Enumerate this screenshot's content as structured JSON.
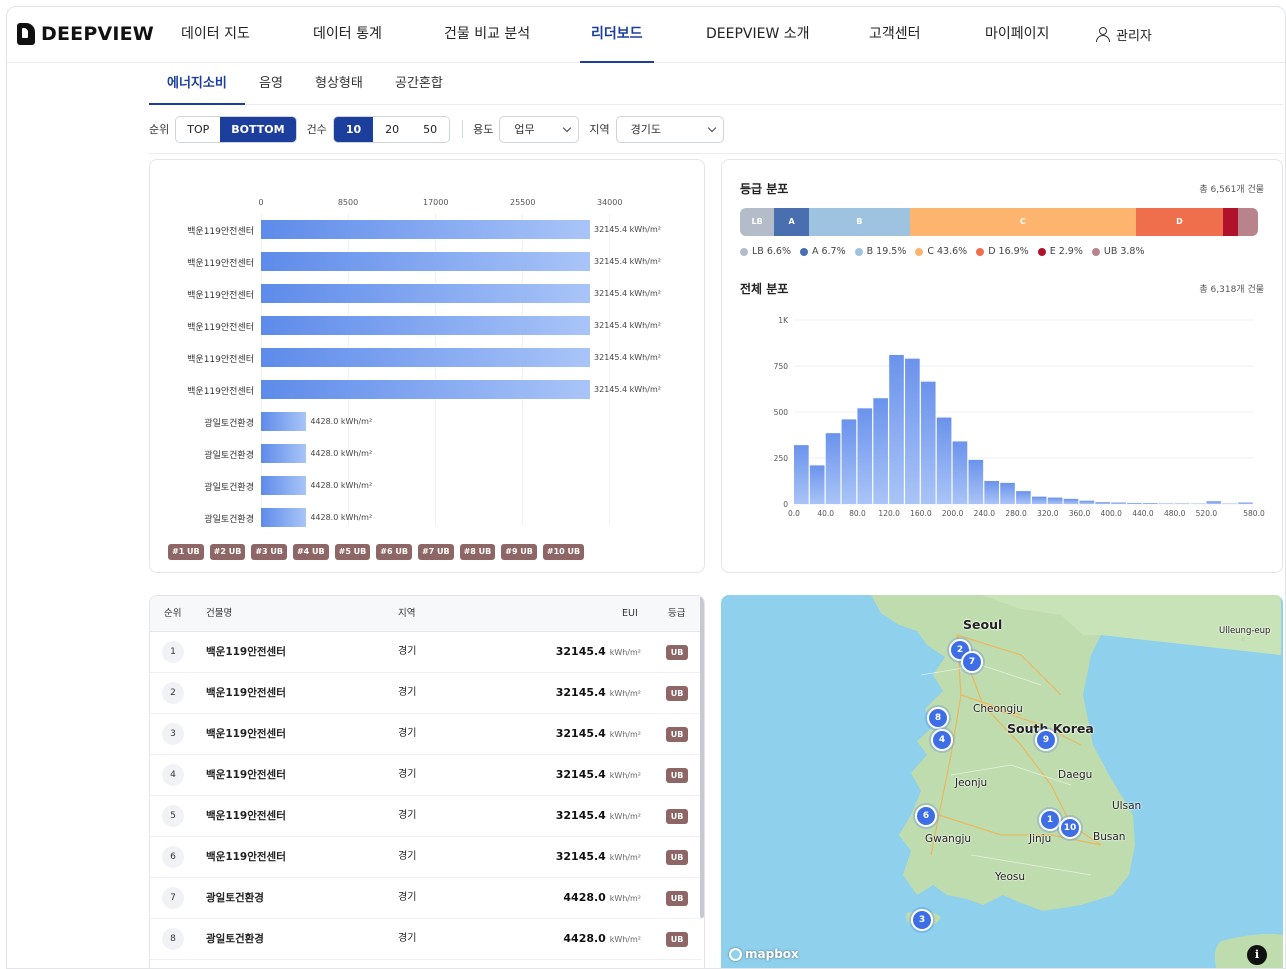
{
  "app": {
    "logo": "DEEPVIEW"
  },
  "nav": {
    "items": [
      "데이터 지도",
      "데이터 통계",
      "건물 비교 분석",
      "리더보드",
      "DEEPVIEW 소개",
      "고객센터",
      "마이페이지"
    ],
    "active": "리더보드",
    "user": "관리자"
  },
  "subtabs": {
    "items": [
      "에너지소비",
      "음영",
      "형상형태",
      "공간혼합"
    ],
    "active": "에너지소비"
  },
  "filters": {
    "rank_label": "순위",
    "rank_options": [
      "TOP",
      "BOTTOM"
    ],
    "rank_selected": "BOTTOM",
    "count_label": "건수",
    "count_options": [
      "10",
      "20",
      "50"
    ],
    "count_selected": "10",
    "use_label": "용도",
    "use_value": "업무",
    "region_label": "지역",
    "region_value": "경기도"
  },
  "chart_data": [
    {
      "type": "bar",
      "orientation": "horizontal",
      "x_ticks": [
        "0",
        "8500",
        "17000",
        "25500",
        "34000"
      ],
      "xlim": [
        0,
        34000
      ],
      "categories": [
        "백운119안전센터",
        "백운119안전센터",
        "백운119안전센터",
        "백운119안전센터",
        "백운119안전센터",
        "백운119안전센터",
        "광일토건환경",
        "광일토건환경",
        "광일토건환경",
        "광일토건환경"
      ],
      "values": [
        32145.4,
        32145.4,
        32145.4,
        32145.4,
        32145.4,
        32145.4,
        4428.0,
        4428.0,
        4428.0,
        4428.0
      ],
      "value_labels": [
        "32145.4 kWh/m²",
        "32145.4 kWh/m²",
        "32145.4 kWh/m²",
        "32145.4 kWh/m²",
        "32145.4 kWh/m²",
        "32145.4 kWh/m²",
        "4428.0 kWh/m²",
        "4428.0 kWh/m²",
        "4428.0 kWh/m²",
        "4428.0 kWh/m²"
      ],
      "chips": [
        "#1 UB",
        "#2 UB",
        "#3 UB",
        "#4 UB",
        "#5 UB",
        "#6 UB",
        "#7 UB",
        "#8 UB",
        "#9 UB",
        "#10 UB"
      ]
    },
    {
      "type": "bar",
      "orientation": "stacked-horizontal",
      "title": "등급 분포",
      "subtitle": "총 6,561개 건물",
      "categories": [
        "LB",
        "A",
        "B",
        "C",
        "D",
        "E",
        "UB"
      ],
      "values": [
        6.6,
        6.7,
        19.5,
        43.6,
        16.9,
        2.9,
        3.8
      ],
      "legend": [
        "LB 6.6%",
        "A 6.7%",
        "B 19.5%",
        "C 43.6%",
        "D 16.9%",
        "E 2.9%",
        "UB 3.8%"
      ],
      "colors": [
        "#b3bcc8",
        "#4a6fb0",
        "#9ec3e0",
        "#fdb46e",
        "#ef6f4c",
        "#b0122b",
        "#b8838a"
      ]
    },
    {
      "type": "bar",
      "title": "전체 분포",
      "subtitle": "총 6,318개 건물",
      "y_ticks": [
        "0",
        "250",
        "500",
        "750",
        "1K"
      ],
      "ylim": [
        0,
        1000
      ],
      "x_ticks": [
        "0.0",
        "40.0",
        "80.0",
        "120.0",
        "160.0",
        "200.0",
        "240.0",
        "280.0",
        "320.0",
        "360.0",
        "400.0",
        "440.0",
        "480.0",
        "520.0",
        "580.0"
      ],
      "bin_width": 20,
      "bins_start": [
        0,
        20,
        40,
        60,
        80,
        100,
        120,
        140,
        160,
        180,
        200,
        220,
        240,
        260,
        280,
        300,
        320,
        340,
        360,
        380,
        400,
        420,
        440,
        460,
        480,
        500,
        520,
        540,
        560
      ],
      "values": [
        320,
        210,
        385,
        460,
        520,
        575,
        810,
        790,
        665,
        470,
        340,
        240,
        125,
        115,
        70,
        40,
        35,
        28,
        18,
        10,
        8,
        6,
        5,
        3,
        3,
        2,
        15,
        2,
        8
      ]
    }
  ],
  "table": {
    "headers": {
      "rank": "순위",
      "name": "건물명",
      "region": "지역",
      "eui": "EUI",
      "grade": "등급"
    },
    "unit": "kWh/m²",
    "rows": [
      {
        "rank": "1",
        "name": "백운119안전센터",
        "region": "경기",
        "eui": "32145.4",
        "grade": "UB"
      },
      {
        "rank": "2",
        "name": "백운119안전센터",
        "region": "경기",
        "eui": "32145.4",
        "grade": "UB"
      },
      {
        "rank": "3",
        "name": "백운119안전센터",
        "region": "경기",
        "eui": "32145.4",
        "grade": "UB"
      },
      {
        "rank": "4",
        "name": "백운119안전센터",
        "region": "경기",
        "eui": "32145.4",
        "grade": "UB"
      },
      {
        "rank": "5",
        "name": "백운119안전센터",
        "region": "경기",
        "eui": "32145.4",
        "grade": "UB"
      },
      {
        "rank": "6",
        "name": "백운119안전센터",
        "region": "경기",
        "eui": "32145.4",
        "grade": "UB"
      },
      {
        "rank": "7",
        "name": "광일토건환경",
        "region": "경기",
        "eui": "4428.0",
        "grade": "UB"
      },
      {
        "rank": "8",
        "name": "광일토건환경",
        "region": "경기",
        "eui": "4428.0",
        "grade": "UB"
      }
    ]
  },
  "map": {
    "cities": [
      "Seoul",
      "Cheongju",
      "South Korea",
      "Daegu",
      "Jeonju",
      "Ulsan",
      "Gwangju",
      "Jinju",
      "Busan",
      "Yeosu",
      "Ulleung-eup"
    ],
    "markers": [
      "1",
      "2",
      "3",
      "4",
      "6",
      "7",
      "8",
      "9",
      "10"
    ],
    "attribution": "mapbox",
    "info": "i",
    "colors": {
      "sea": "#8fd0ec",
      "land": "#bfdcae",
      "marker": "#3e6ee5"
    }
  },
  "colors": {
    "accent": "#1c3f9e",
    "ub": "#8e6666"
  }
}
